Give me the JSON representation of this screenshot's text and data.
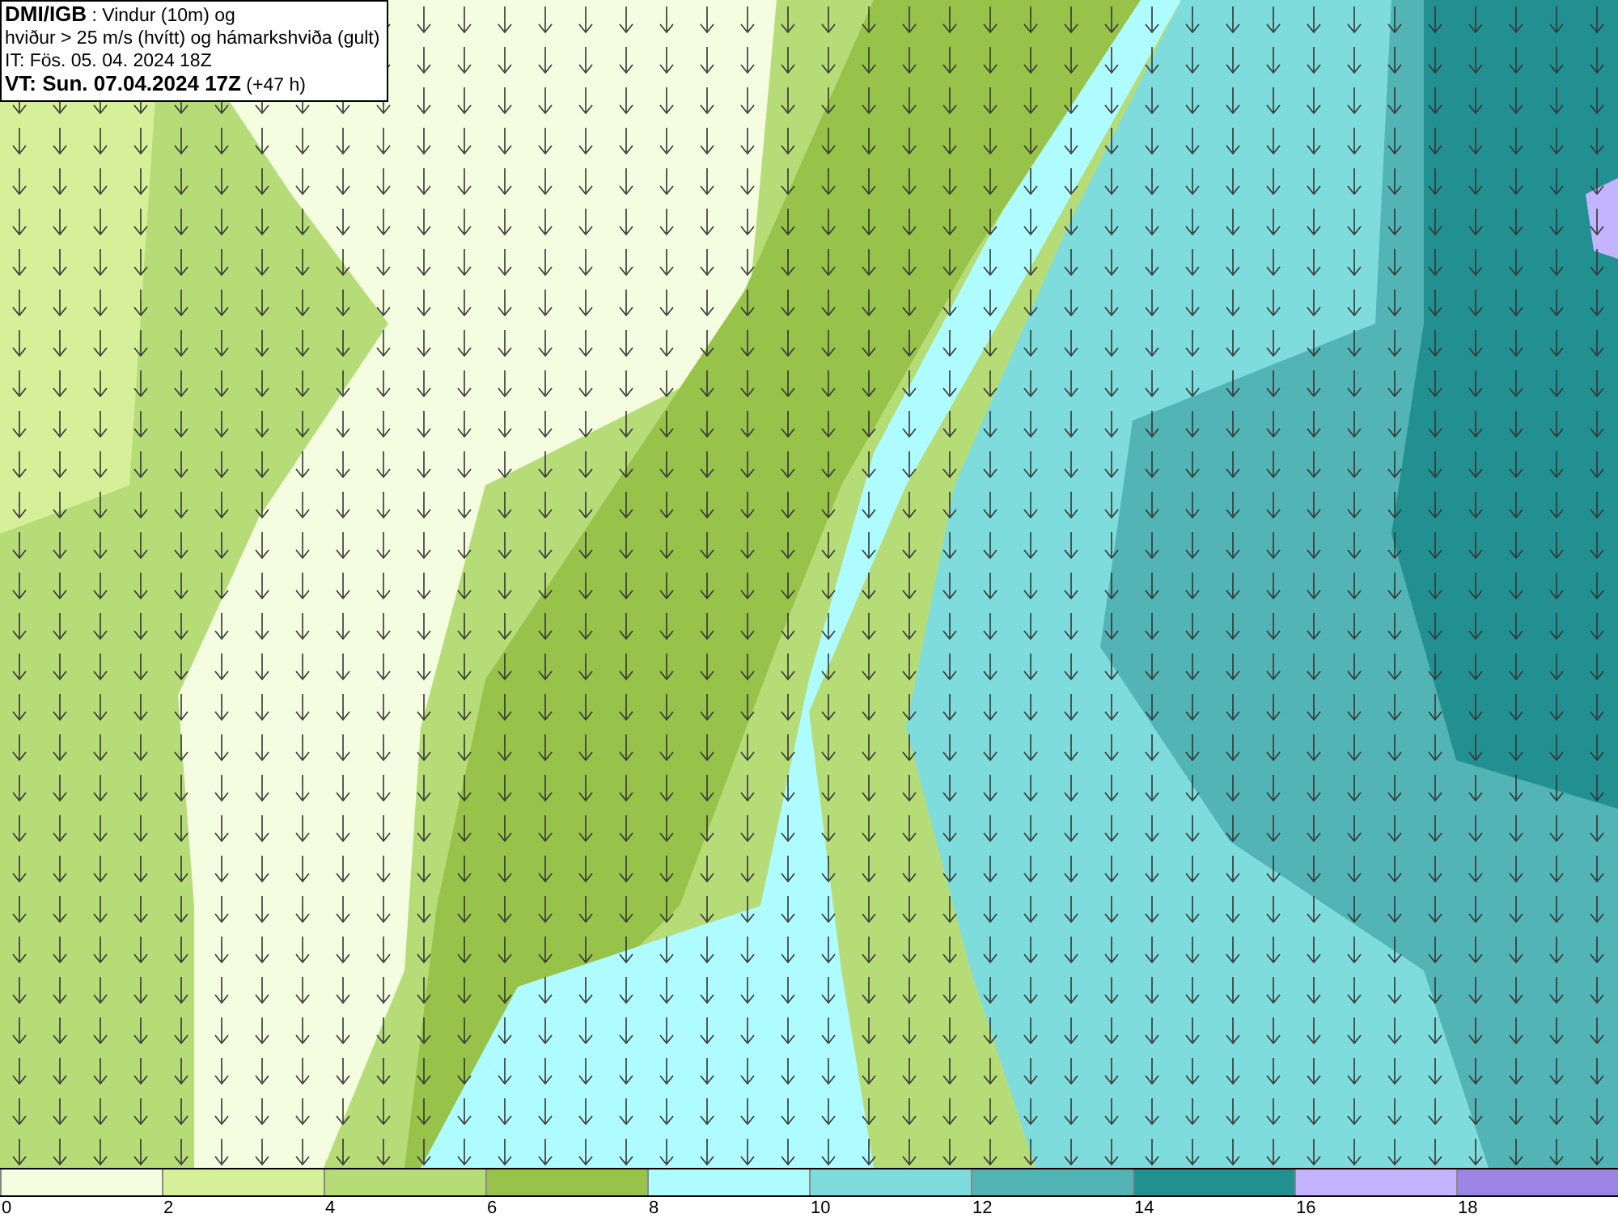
{
  "title_box": {
    "lines": [
      "**DMI/IGB** : Vindur (10m) og",
      "hviður > 25 m/s (hvítt) og hámarkshviða (gult)",
      "IT: Fös. 05. 04. 2024 18Z",
      "**VT: Sun. 07.04.2024 17Z** (+47 h)"
    ]
  },
  "legend": {
    "items": [
      {
        "label": "0",
        "color": "#f5fde0"
      },
      {
        "label": "2",
        "color": "#d6f09a"
      },
      {
        "label": "4",
        "color": "#b6dc78"
      },
      {
        "label": "6",
        "color": "#97c34a"
      },
      {
        "label": "8",
        "color": "#aefcff"
      },
      {
        "label": "10",
        "color": "#7edcdc"
      },
      {
        "label": "12",
        "color": "#52b4b4"
      },
      {
        "label": "14",
        "color": "#229090"
      },
      {
        "label": "16",
        "color": "#c4b4ff"
      },
      {
        "label": "18",
        "color": "#9b84e4"
      }
    ]
  }
}
